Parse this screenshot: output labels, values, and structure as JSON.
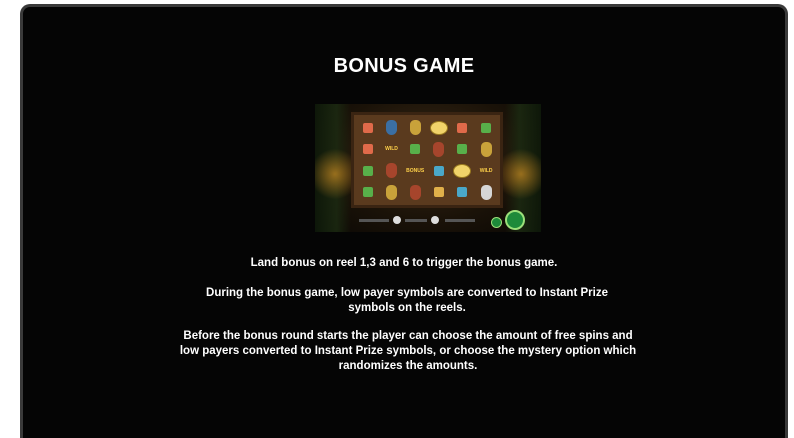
{
  "title": "BONUS GAME",
  "paragraphs": [
    "Land bonus on reel 1,3 and 6 to trigger the bonus game.",
    "During the bonus game, low payer symbols are converted to Instant Prize symbols on the reels.",
    "Before the bonus round starts the player can choose the amount of free spins and low payers converted to Instant Prize symbols, or choose the mystery option which randomizes the amounts."
  ],
  "screenshot": {
    "labels": {
      "wild_a": "WILD",
      "bonus": "BONUS",
      "wild_b": "WILD"
    }
  },
  "colors": {
    "background": "#050505",
    "text": "#ffffff",
    "frame_border": "#3a3a3a"
  }
}
